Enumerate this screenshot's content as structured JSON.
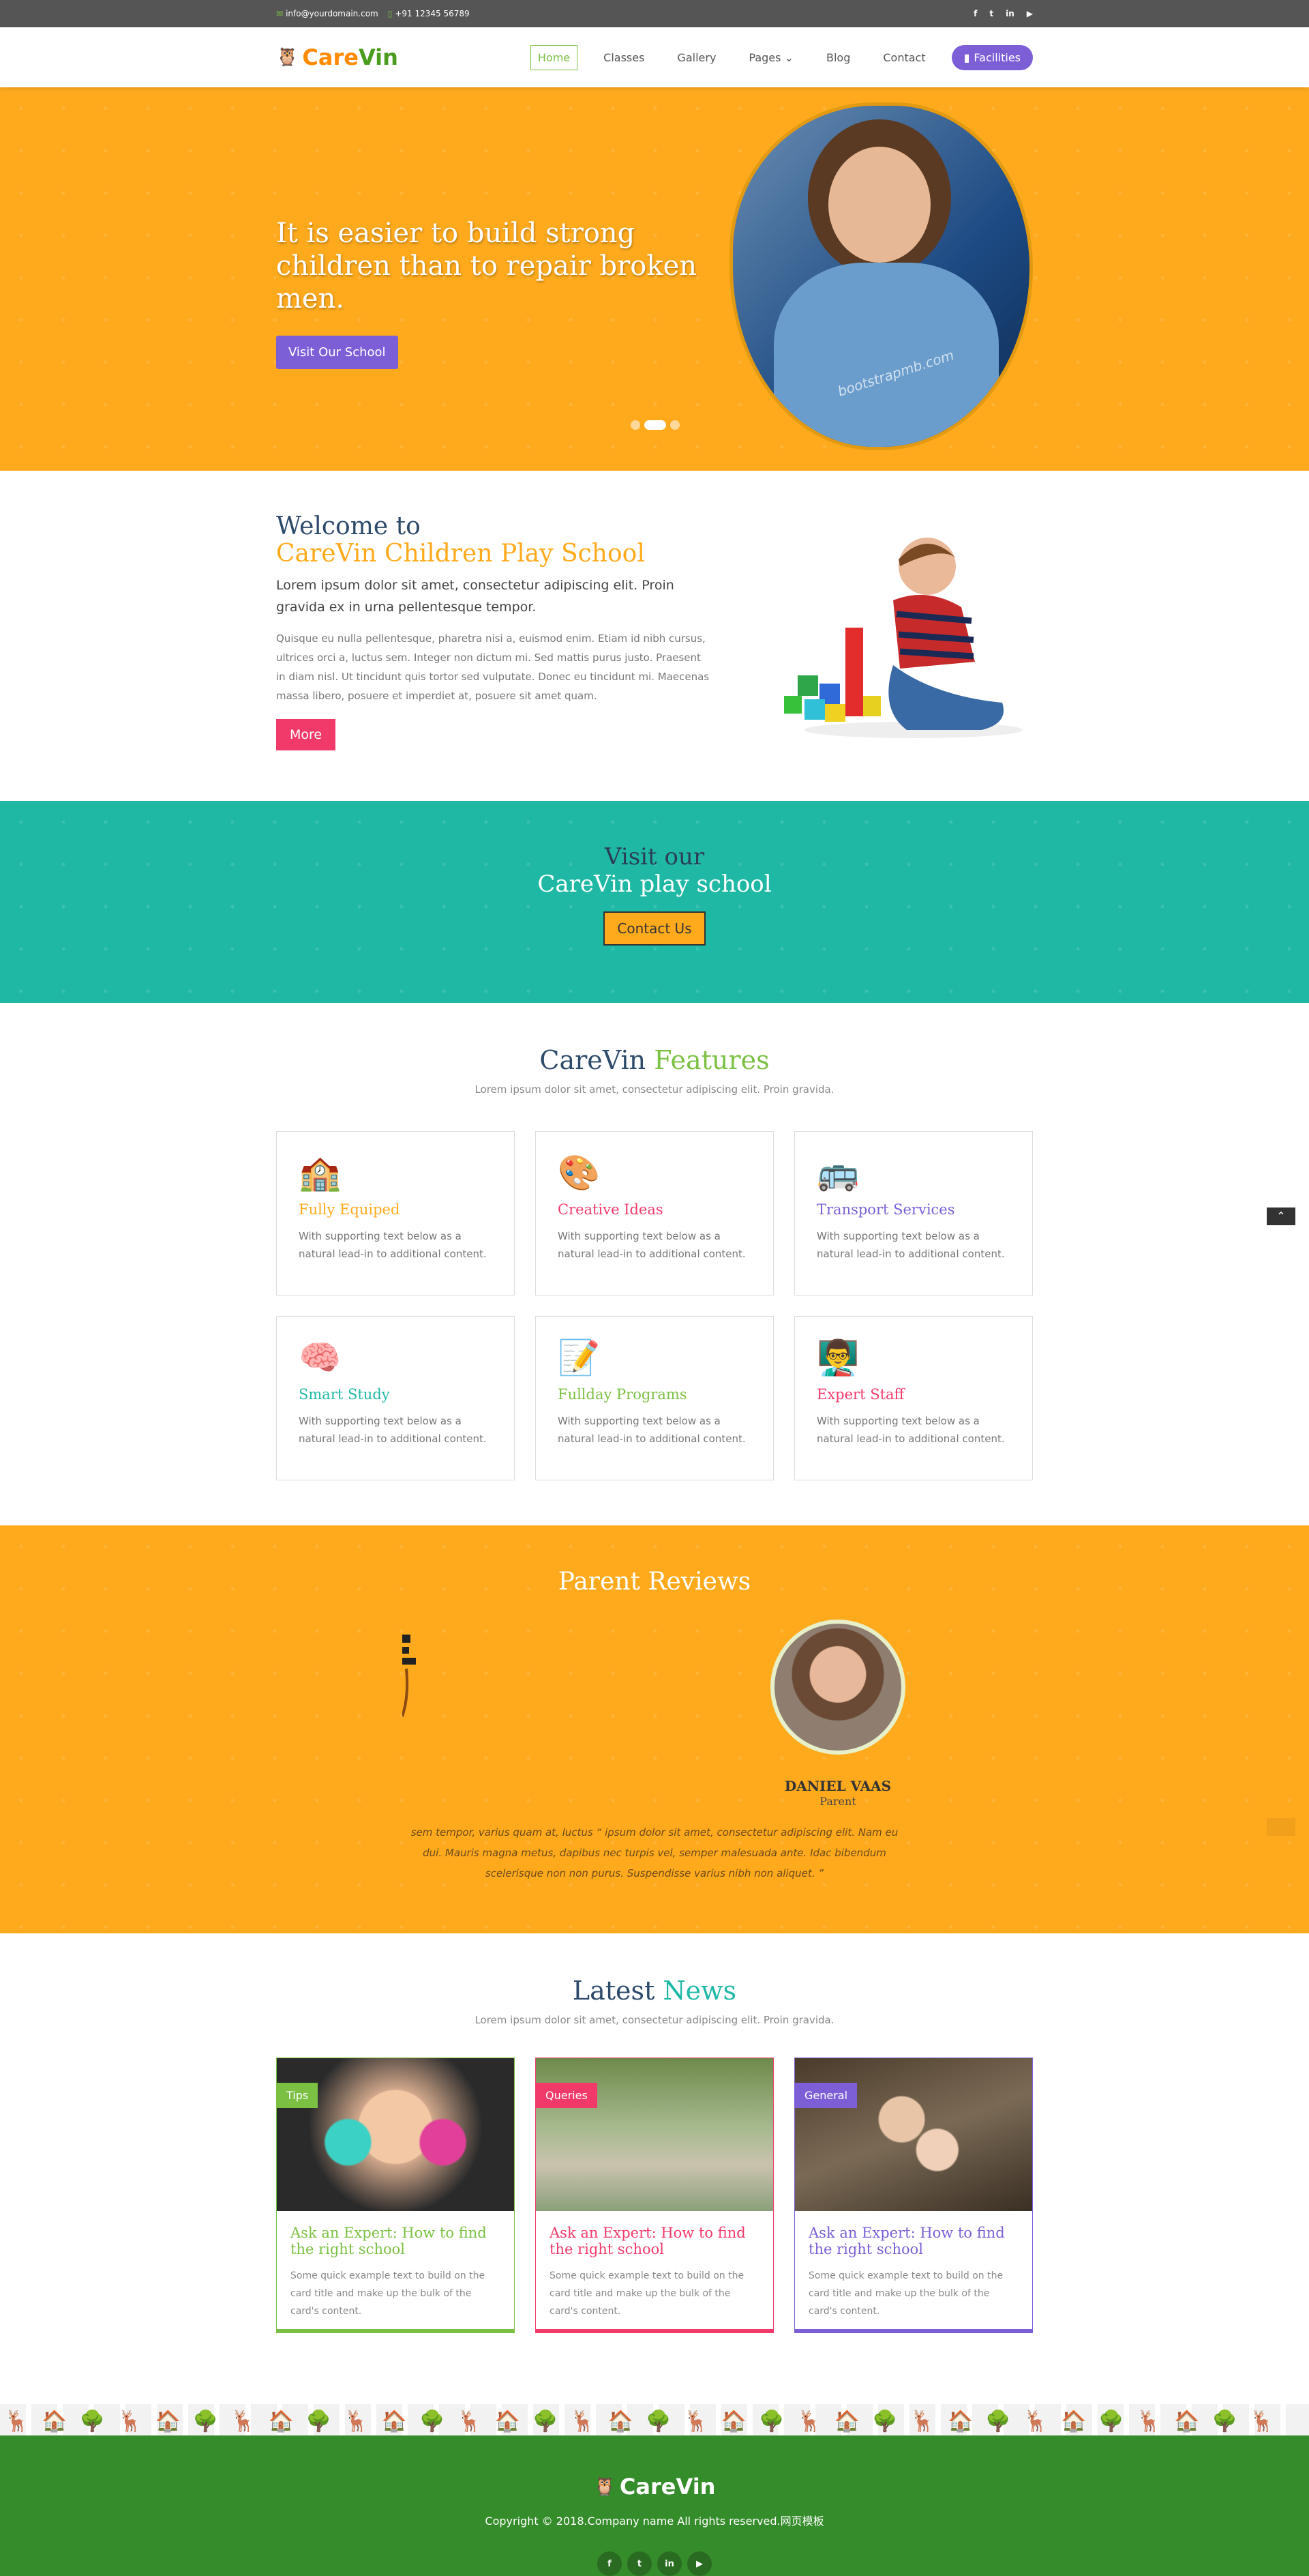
{
  "topbar": {
    "email": "info@yourdomain.com",
    "phone": "+91 12345 56789",
    "social": [
      "f",
      "t",
      "in",
      "yt"
    ]
  },
  "brand": {
    "part1": "Care",
    "part2": "Vin",
    "icon": "owl-logo-icon"
  },
  "nav": {
    "items": [
      "Home",
      "Classes",
      "Gallery",
      "Pages",
      "Blog",
      "Contact"
    ],
    "active": "Home",
    "facilities": "Facilities"
  },
  "hero": {
    "headline": "It is easier to build strong children than to repair broken men.",
    "button": "Visit Our School",
    "slides": 3,
    "active_slide": 2,
    "watermark": "bootstrapmb.com"
  },
  "welcome": {
    "title1": "Welcome to",
    "title2": "CareVin Children Play School",
    "lead": "Lorem ipsum dolor sit amet, consectetur adipiscing elit. Proin gravida ex in urna pellentesque tempor.",
    "body": "Quisque eu nulla pellentesque, pharetra nisi a, euismod enim. Etiam id nibh cursus, ultrices orci a, luctus sem. Integer non dictum mi. Sed mattis purus justo. Praesent in diam nisl. Ut tincidunt quis tortor sed vulputate. Donec eu tincidunt mi. Maecenas massa libero, posuere et imperdiet at, posuere sit amet quam.",
    "button": "More"
  },
  "visit": {
    "line1": "Visit our",
    "line2": "CareVin play school",
    "button": "Contact Us"
  },
  "features": {
    "title1": "CareVin",
    "title2": "Features",
    "sub": "Lorem ipsum dolor sit amet, consectetur adipiscing elit. Proin gravida.",
    "items": [
      {
        "title": "Fully Equiped",
        "text": "With supporting text below as a natural lead-in to additional content.",
        "color": "#ffaa1d",
        "icon": "school-building-icon"
      },
      {
        "title": "Creative Ideas",
        "text": "With supporting text below as a natural lead-in to additional content.",
        "color": "#f13a6a",
        "icon": "creative-ideas-icon"
      },
      {
        "title": "Transport Services",
        "text": "With supporting text below as a natural lead-in to additional content.",
        "color": "#7c5fd6",
        "icon": "school-bus-icon"
      },
      {
        "title": "Smart Study",
        "text": "With supporting text below as a natural lead-in to additional content.",
        "color": "#1fb8a5",
        "icon": "smart-study-icon"
      },
      {
        "title": "Fullday Programs",
        "text": "With supporting text below as a natural lead-in to additional content.",
        "color": "#7bc043",
        "icon": "checklist-icon"
      },
      {
        "title": "Expert Staff",
        "text": "With supporting text below as a natural lead-in to additional content.",
        "color": "#f13a6a",
        "icon": "teacher-icon"
      }
    ]
  },
  "reviews": {
    "title": "Parent Reviews",
    "name": "DANIEL VAAS",
    "role": "Parent",
    "text_left": "sem tempor, varius quam at, luctus",
    "quote": "ipsum dolor sit amet, consectetur adipiscing elit. Nam eu dui. Mauris magna metus, dapibus nec turpis vel, semper malesuada ante. Idac bibendum scelerisque non non purus. Suspendisse varius nibh non aliquet."
  },
  "news": {
    "title1": "Latest",
    "title2": "News",
    "sub": "Lorem ipsum dolor sit amet, consectetur adipiscing elit. Proin gravida.",
    "items": [
      {
        "tag": "Tips",
        "title": "Ask an Expert: How to find the right school",
        "text": "Some quick example text to build on the card title and make up the bulk of the card's content.",
        "color": "#7bc043"
      },
      {
        "tag": "Queries",
        "title": "Ask an Expert: How to find the right school",
        "text": "Some quick example text to build on the card title and make up the bulk of the card's content.",
        "color": "#f13a6a"
      },
      {
        "tag": "General",
        "title": "Ask an Expert: How to find the right school",
        "text": "Some quick example text to build on the card title and make up the bulk of the card's content.",
        "color": "#7c5fd6"
      }
    ]
  },
  "footer": {
    "brand": "CareVin",
    "copyright": "Copyright © 2018.Company name All rights reserved.网页模板",
    "social": [
      "f",
      "t",
      "in",
      "yt"
    ]
  }
}
